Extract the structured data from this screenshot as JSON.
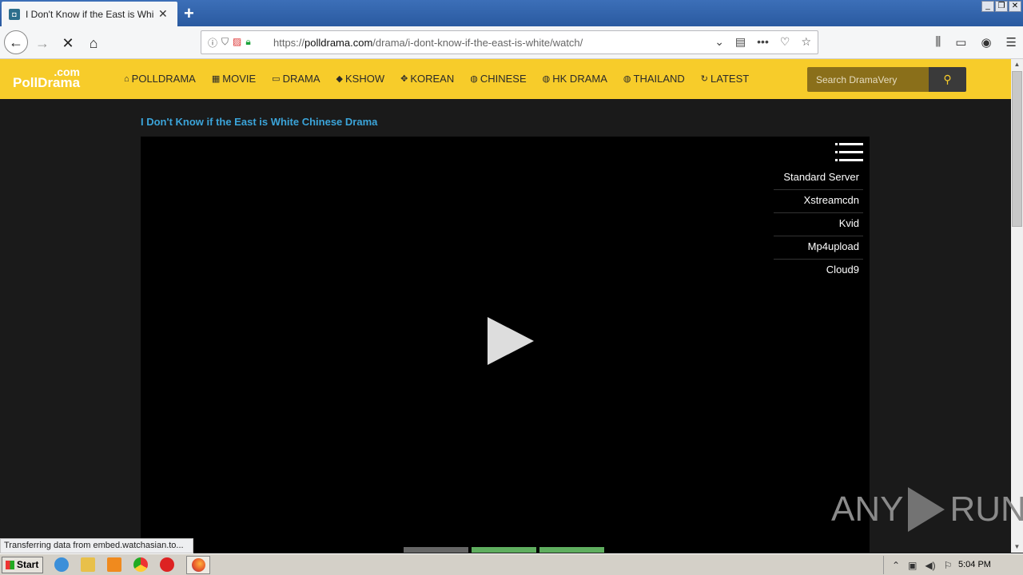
{
  "browser": {
    "tab_title": "I Don't Know if the East is White E",
    "url_prefix": "https://",
    "url_domain": "polldrama.com",
    "url_path": "/drama/i-dont-know-if-the-east-is-white/watch/"
  },
  "site": {
    "logo_com": ".com",
    "logo_name": "PollDrama",
    "menu": [
      {
        "label": "POLLDRAMA"
      },
      {
        "label": "MOVIE"
      },
      {
        "label": "DRAMA"
      },
      {
        "label": "KSHOW"
      },
      {
        "label": "KOREAN"
      },
      {
        "label": "CHINESE"
      },
      {
        "label": "HK DRAMA"
      },
      {
        "label": "THAILAND"
      },
      {
        "label": "LATEST"
      }
    ],
    "search_placeholder": "Search DramaVery"
  },
  "main": {
    "title": "I Don't Know if the East is White Chinese Drama",
    "servers": [
      {
        "label": "Standard Server"
      },
      {
        "label": "Xstreamcdn"
      },
      {
        "label": "Kvid"
      },
      {
        "label": "Mp4upload"
      },
      {
        "label": "Cloud9"
      }
    ]
  },
  "status_text": "Transferring data from embed.watchasian.to...",
  "watermark": {
    "left": "ANY",
    "right": "RUN"
  },
  "taskbar": {
    "start_label": "Start",
    "clock": "5:04 PM"
  },
  "colors": {
    "header": "#f7cc2a",
    "title": "#3ba4d9",
    "bar_gray": "#666666",
    "bar_green": "#5fae5f"
  }
}
